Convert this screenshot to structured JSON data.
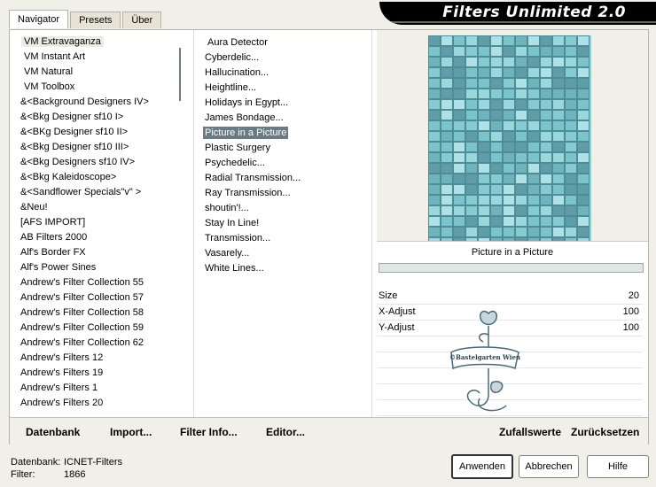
{
  "tabs": [
    {
      "label": "Navigator",
      "active": true
    },
    {
      "label": "Presets",
      "active": false
    },
    {
      "label": "Über",
      "active": false
    }
  ],
  "title": "Filters Unlimited 2.0",
  "categories": [
    "VM Extravaganza",
    "VM Instant Art",
    "VM Natural",
    "VM Toolbox",
    "&<Background Designers IV>",
    "&<Bkg Designer sf10 I>",
    "&<BKg Designer sf10 II>",
    "&<Bkg Designer sf10 III>",
    "&<Bkg Designers sf10 IV>",
    "&<Bkg Kaleidoscope>",
    "&<Sandflower Specials\"v\" >",
    "&Neu!",
    "[AFS IMPORT]",
    "AB Filters 2000",
    "Alf's Border FX",
    "Alf's Power Sines",
    "Andrew's Filter Collection 55",
    "Andrew's Filter Collection 57",
    "Andrew's Filter Collection 58",
    "Andrew's Filter Collection 59",
    "Andrew's Filter Collection 62",
    "Andrew's Filters 12",
    "Andrew's Filters 19",
    "Andrew's Filters 1",
    "Andrew's Filters 20"
  ],
  "filters": [
    "Aura Detector",
    "Cyberdelic...",
    "Hallucination...",
    "Heightline...",
    "Holidays in Egypt...",
    "James Bondage...",
    "Picture in a Picture",
    "Plastic Surgery",
    "Psychedelic...",
    "Radial Transmission...",
    "Ray Transmission...",
    "shoutin'!...",
    "Stay In Line!",
    "Transmission...",
    "Vasarely...",
    "White Lines..."
  ],
  "selected_filter": "Picture in a Picture",
  "preview_label": "Picture in a Picture",
  "params": [
    {
      "name": "Size",
      "value": "20"
    },
    {
      "name": "X-Adjust",
      "value": "100"
    },
    {
      "name": "Y-Adjust",
      "value": "100"
    }
  ],
  "watermark_text": "©Bastelgarten Wien",
  "panel_buttons": {
    "datenbank": "Datenbank",
    "import": "Import...",
    "filter_info": "Filter Info...",
    "editor": "Editor...",
    "zufallswerte": "Zufallswerte",
    "zuruecksetzen": "Zurücksetzen"
  },
  "footer": {
    "datenbank_label": "Datenbank:",
    "datenbank_value": "ICNET-Filters",
    "filter_label": "Filter:",
    "filter_value": "1866"
  },
  "dialog_buttons": {
    "apply": "Anwenden",
    "cancel": "Abbrechen",
    "help": "Hilfe"
  },
  "colors": {
    "preview_base": "#8ccfd6",
    "selection": "#6b7b86"
  }
}
